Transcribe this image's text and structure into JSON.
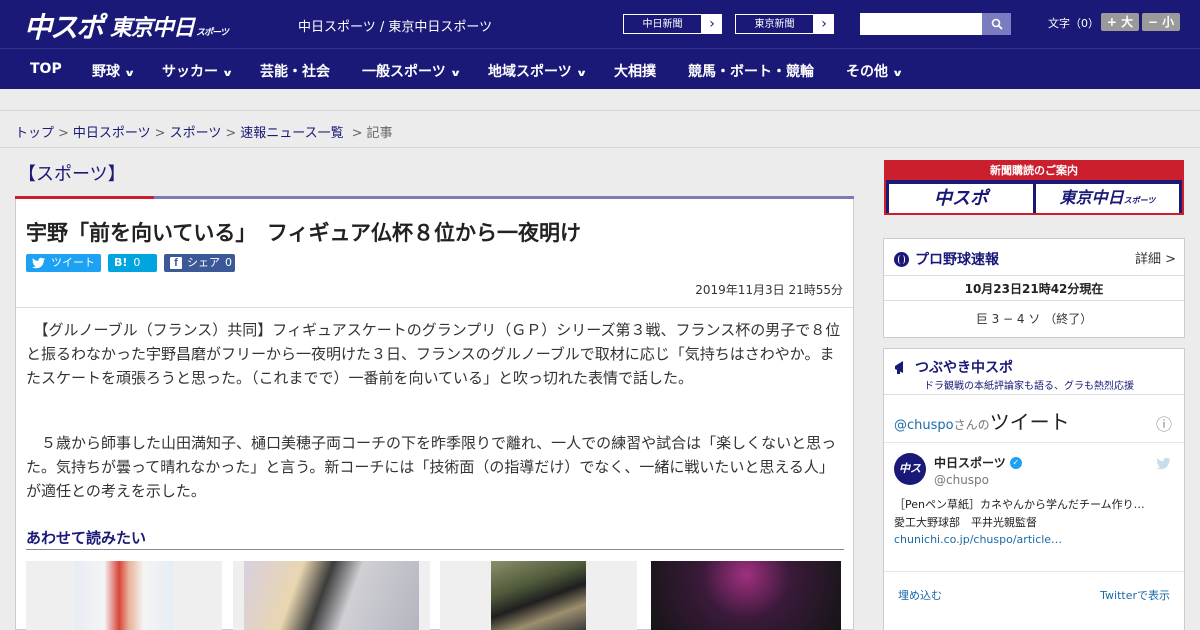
{
  "header": {
    "logo_main": "中スポ",
    "logo_sub": "東京中日",
    "logo_sub_small": "スポーツ",
    "site_title": "中日スポーツ / 東京中日スポーツ",
    "ext_links": [
      "中日新聞",
      "東京新聞"
    ],
    "search_placeholder": "",
    "font_size_label": "文字（0）",
    "font_bigger": "+ 大",
    "font_smaller": "− 小"
  },
  "nav": {
    "items": [
      {
        "label": "TOP",
        "dropdown": false
      },
      {
        "label": "野球",
        "dropdown": true
      },
      {
        "label": "サッカー",
        "dropdown": true
      },
      {
        "label": "芸能・社会",
        "dropdown": false
      },
      {
        "label": "一般スポーツ",
        "dropdown": true
      },
      {
        "label": "地域スポーツ",
        "dropdown": true
      },
      {
        "label": "大相撲",
        "dropdown": false
      },
      {
        "label": "競馬・ボート・競輪",
        "dropdown": false
      },
      {
        "label": "その他",
        "dropdown": true
      }
    ],
    "chevron": "∨"
  },
  "breadcrumb": {
    "items": [
      "トップ",
      "中日スポーツ",
      "スポーツ",
      "速報ニュース一覧",
      "記事"
    ],
    "separator": ">"
  },
  "article": {
    "category": "【スポーツ】",
    "title": "宇野「前を向いている」　フィギュア仏杯８位から一夜明け",
    "share": {
      "tweet": "ツイート",
      "hatena_label": "B!",
      "hatena_count": "0",
      "facebook_label": "シェア",
      "facebook_count": "0"
    },
    "date": "2019年11月3日 21時55分",
    "paragraphs": [
      "　【グルノーブル（フランス）共同】フィギュアスケートのグランプリ（ＧＰ）シリーズ第３戦、フランス杯の男子で８位と振るわなかった宇野昌磨がフリーから一夜明けた３日、フランスのグルノーブルで取材に応じ「気持ちはさわやか。またスケートを頑張ろうと思った。（これまでで）一番前を向いている」と吹っ切れた表情で話した。",
      "　５歳から師事した山田満知子、樋口美穂子両コーチの下を昨季限りで離れ、一人での練習や試合は「楽しくないと思った。気持ちが曇って晴れなかった」と言う。新コーチには「技術面（の指導だけ）でなく、一緒に戦いたいと思える人」が適任との考えを示した。"
    ],
    "related_heading": "あわせて読みたい"
  },
  "sidebar": {
    "ad": {
      "top": "新聞購読のご案内",
      "logo_left": "中スポ",
      "logo_right": "東京中日",
      "logo_right_small": "スポーツ"
    },
    "baseball": {
      "title": "プロ野球速報",
      "detail": "詳細 >",
      "updated": "10月23日21時42分現在",
      "score": "巨 3 − 4 ソ （終了）"
    },
    "tweets": {
      "title": "つぶやき中スポ",
      "subtitle": "ドラ観戦の本紙評論家も語る、グラも熱烈応援",
      "handle_link": "@chuspo",
      "handle_suffix": "さんの",
      "heading": "ツイート",
      "info": "ⓘ",
      "account_name": "中日スポーツ",
      "account_handle": "@chuspo",
      "tweet_text": "［Penペン草紙］カネやんから学んだチーム作り…　愛工大野球部　平井光親監督",
      "tweet_link": "chunichi.co.jp/chuspo/article…",
      "embed": "埋め込む",
      "view_on_twitter": "Twitterで表示"
    }
  },
  "colors": {
    "navy": "#1a1978",
    "red": "#cc1f2e",
    "twitter": "#1da1f2",
    "hatena": "#00a4de",
    "facebook": "#3b5998"
  }
}
